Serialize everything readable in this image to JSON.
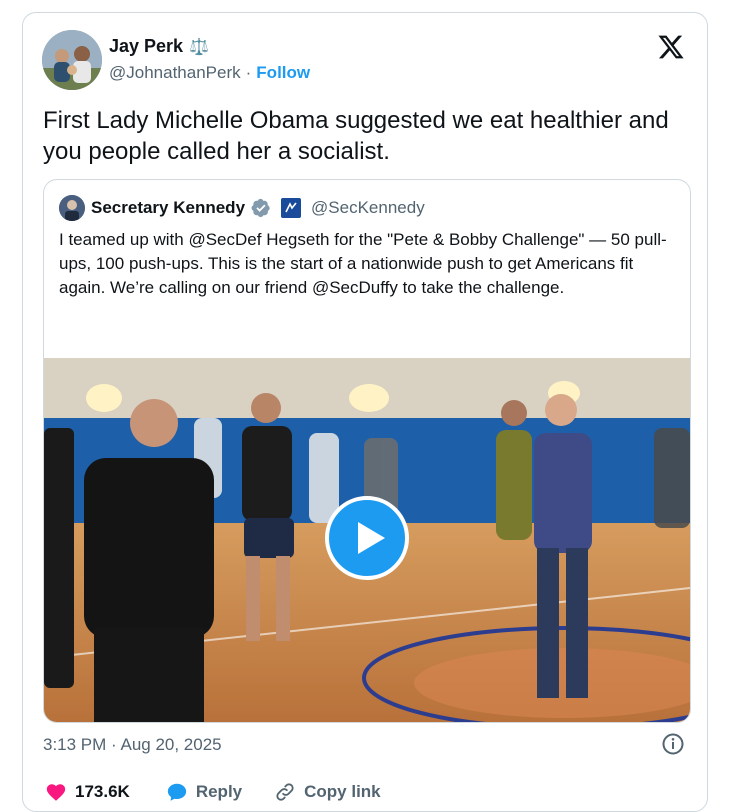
{
  "tweet": {
    "author_name": "Jay Perk",
    "author_emoji": "⚖️",
    "author_handle": "@JohnathanPerk",
    "separator": "·",
    "follow_label": "Follow",
    "text": "First Lady Michelle Obama suggested we eat healthier and you people called her a socialist.",
    "timestamp": "3:13 PM · Aug 20, 2025"
  },
  "quoted": {
    "author_name": "Secretary Kennedy",
    "author_handle": "@SecKennedy",
    "text": "I teamed up with @SecDef Hegseth for the \"Pete & Bobby Challenge\" — 50 pull-ups, 100 push-ups. This is the start of a nationwide push to get Americans fit again. We’re calling on our friend @SecDuffy to take the challenge."
  },
  "actions": {
    "likes": "173.6K",
    "reply_label": "Reply",
    "copy_link_label": "Copy link"
  },
  "colors": {
    "accent": "#1d9bf0",
    "like": "#f91880",
    "muted": "#536471",
    "border": "#cfd9de"
  },
  "icons": [
    "x-logo-icon",
    "verified-badge-icon",
    "hhs-affiliate-icon",
    "play-icon",
    "info-icon",
    "heart-icon",
    "reply-bubble-icon",
    "link-icon"
  ]
}
